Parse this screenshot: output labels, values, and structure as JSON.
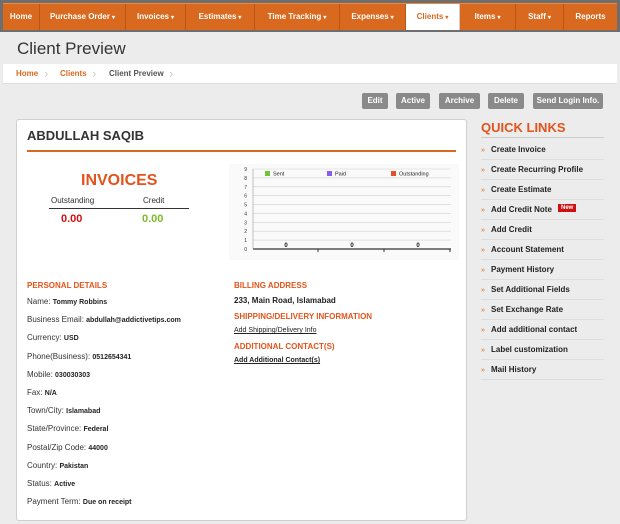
{
  "nav": [
    {
      "label": "Home",
      "caret": ""
    },
    {
      "label": "Purchase Order",
      "caret": "▾"
    },
    {
      "label": "Invoices",
      "caret": "▾"
    },
    {
      "label": "Estimates",
      "caret": "▾"
    },
    {
      "label": "Time Tracking",
      "caret": "▾"
    },
    {
      "label": "Expenses",
      "caret": "▾"
    },
    {
      "label": "Clients",
      "caret": "▾"
    },
    {
      "label": "Items",
      "caret": "▾"
    },
    {
      "label": "Staff",
      "caret": "▾"
    },
    {
      "label": "Reports",
      "caret": ""
    }
  ],
  "nav_active": "Clients",
  "page_title": "Client Preview",
  "breadcrumb": {
    "home": "Home",
    "clients": "Clients",
    "current": "Client Preview"
  },
  "actions": {
    "edit": "Edit",
    "active": "Active",
    "archive": "Archive",
    "delete": "Delete",
    "send_login": "Send Login Info."
  },
  "client": {
    "name": "ABDULLAH SAQIB"
  },
  "invoices": {
    "title": "INVOICES",
    "outstanding_label": "Outstanding",
    "credit_label": "Credit",
    "outstanding_value": "0.00",
    "credit_value": "0.00"
  },
  "chart_data": {
    "type": "bar",
    "categories": [
      "",
      "",
      ""
    ],
    "series": [
      {
        "name": "Sent",
        "values": [
          0,
          0,
          0
        ],
        "color": "#6fc43a"
      },
      {
        "name": "Paid",
        "values": [
          0,
          0,
          0
        ],
        "color": "#8a5cf0"
      },
      {
        "name": "Outstanding",
        "values": [
          0,
          0,
          0
        ],
        "color": "#e8502a"
      }
    ],
    "data_labels": [
      "0",
      "0",
      "0"
    ],
    "ylim": [
      0,
      9
    ],
    "yticks": [
      0,
      1,
      2,
      3,
      4,
      5,
      6,
      7,
      8,
      9
    ],
    "grid": true,
    "legend": "top"
  },
  "personal": {
    "heading": "PERSONAL DETAILS",
    "fields": [
      {
        "label": "Name:",
        "value": "Tommy Robbins"
      },
      {
        "label": "Business Email:",
        "value": "abdullah@addictivetips.com"
      },
      {
        "label": "Currency:",
        "value": "USD"
      },
      {
        "label": "Phone(Business):",
        "value": "0512654341"
      },
      {
        "label": "Mobile:",
        "value": "030030303"
      },
      {
        "label": "Fax:",
        "value": "N/A"
      },
      {
        "label": "Town/City:",
        "value": "Islamabad"
      },
      {
        "label": "State/Province:",
        "value": "Federal"
      },
      {
        "label": "Postal/Zip Code:",
        "value": "44000"
      },
      {
        "label": "Country:",
        "value": "Pakistan"
      },
      {
        "label": "Status:",
        "value": "Active"
      },
      {
        "label": "Payment Term:",
        "value": "Due on receipt"
      }
    ]
  },
  "billing": {
    "heading": "BILLING ADDRESS",
    "address": "233, Main Road, Islamabad"
  },
  "shipping": {
    "heading": "SHIPPING/DELIVERY INFORMATION",
    "link": "Add Shipping/Delivery Info"
  },
  "contacts": {
    "heading": "ADDITIONAL CONTACT(S)",
    "link": "Add Additional Contact(s)"
  },
  "quick_links": {
    "title": "QUICK LINKS",
    "arrow": "»",
    "items": [
      {
        "label": "Create Invoice",
        "badge": ""
      },
      {
        "label": "Create Recurring Profile",
        "badge": ""
      },
      {
        "label": "Create Estimate",
        "badge": ""
      },
      {
        "label": "Add Credit Note",
        "badge": "New"
      },
      {
        "label": "Add Credit",
        "badge": ""
      },
      {
        "label": "Account Statement",
        "badge": ""
      },
      {
        "label": "Payment History",
        "badge": ""
      },
      {
        "label": "Set Additional Fields",
        "badge": ""
      },
      {
        "label": "Set Exchange Rate",
        "badge": ""
      },
      {
        "label": "Add additional contact",
        "badge": ""
      },
      {
        "label": "Label customization",
        "badge": ""
      },
      {
        "label": "Mail History",
        "badge": ""
      }
    ]
  },
  "colors": {
    "accent": "#d9691f",
    "heading": "#e2541c",
    "outstanding": "#d01010",
    "credit": "#7fba2a"
  }
}
